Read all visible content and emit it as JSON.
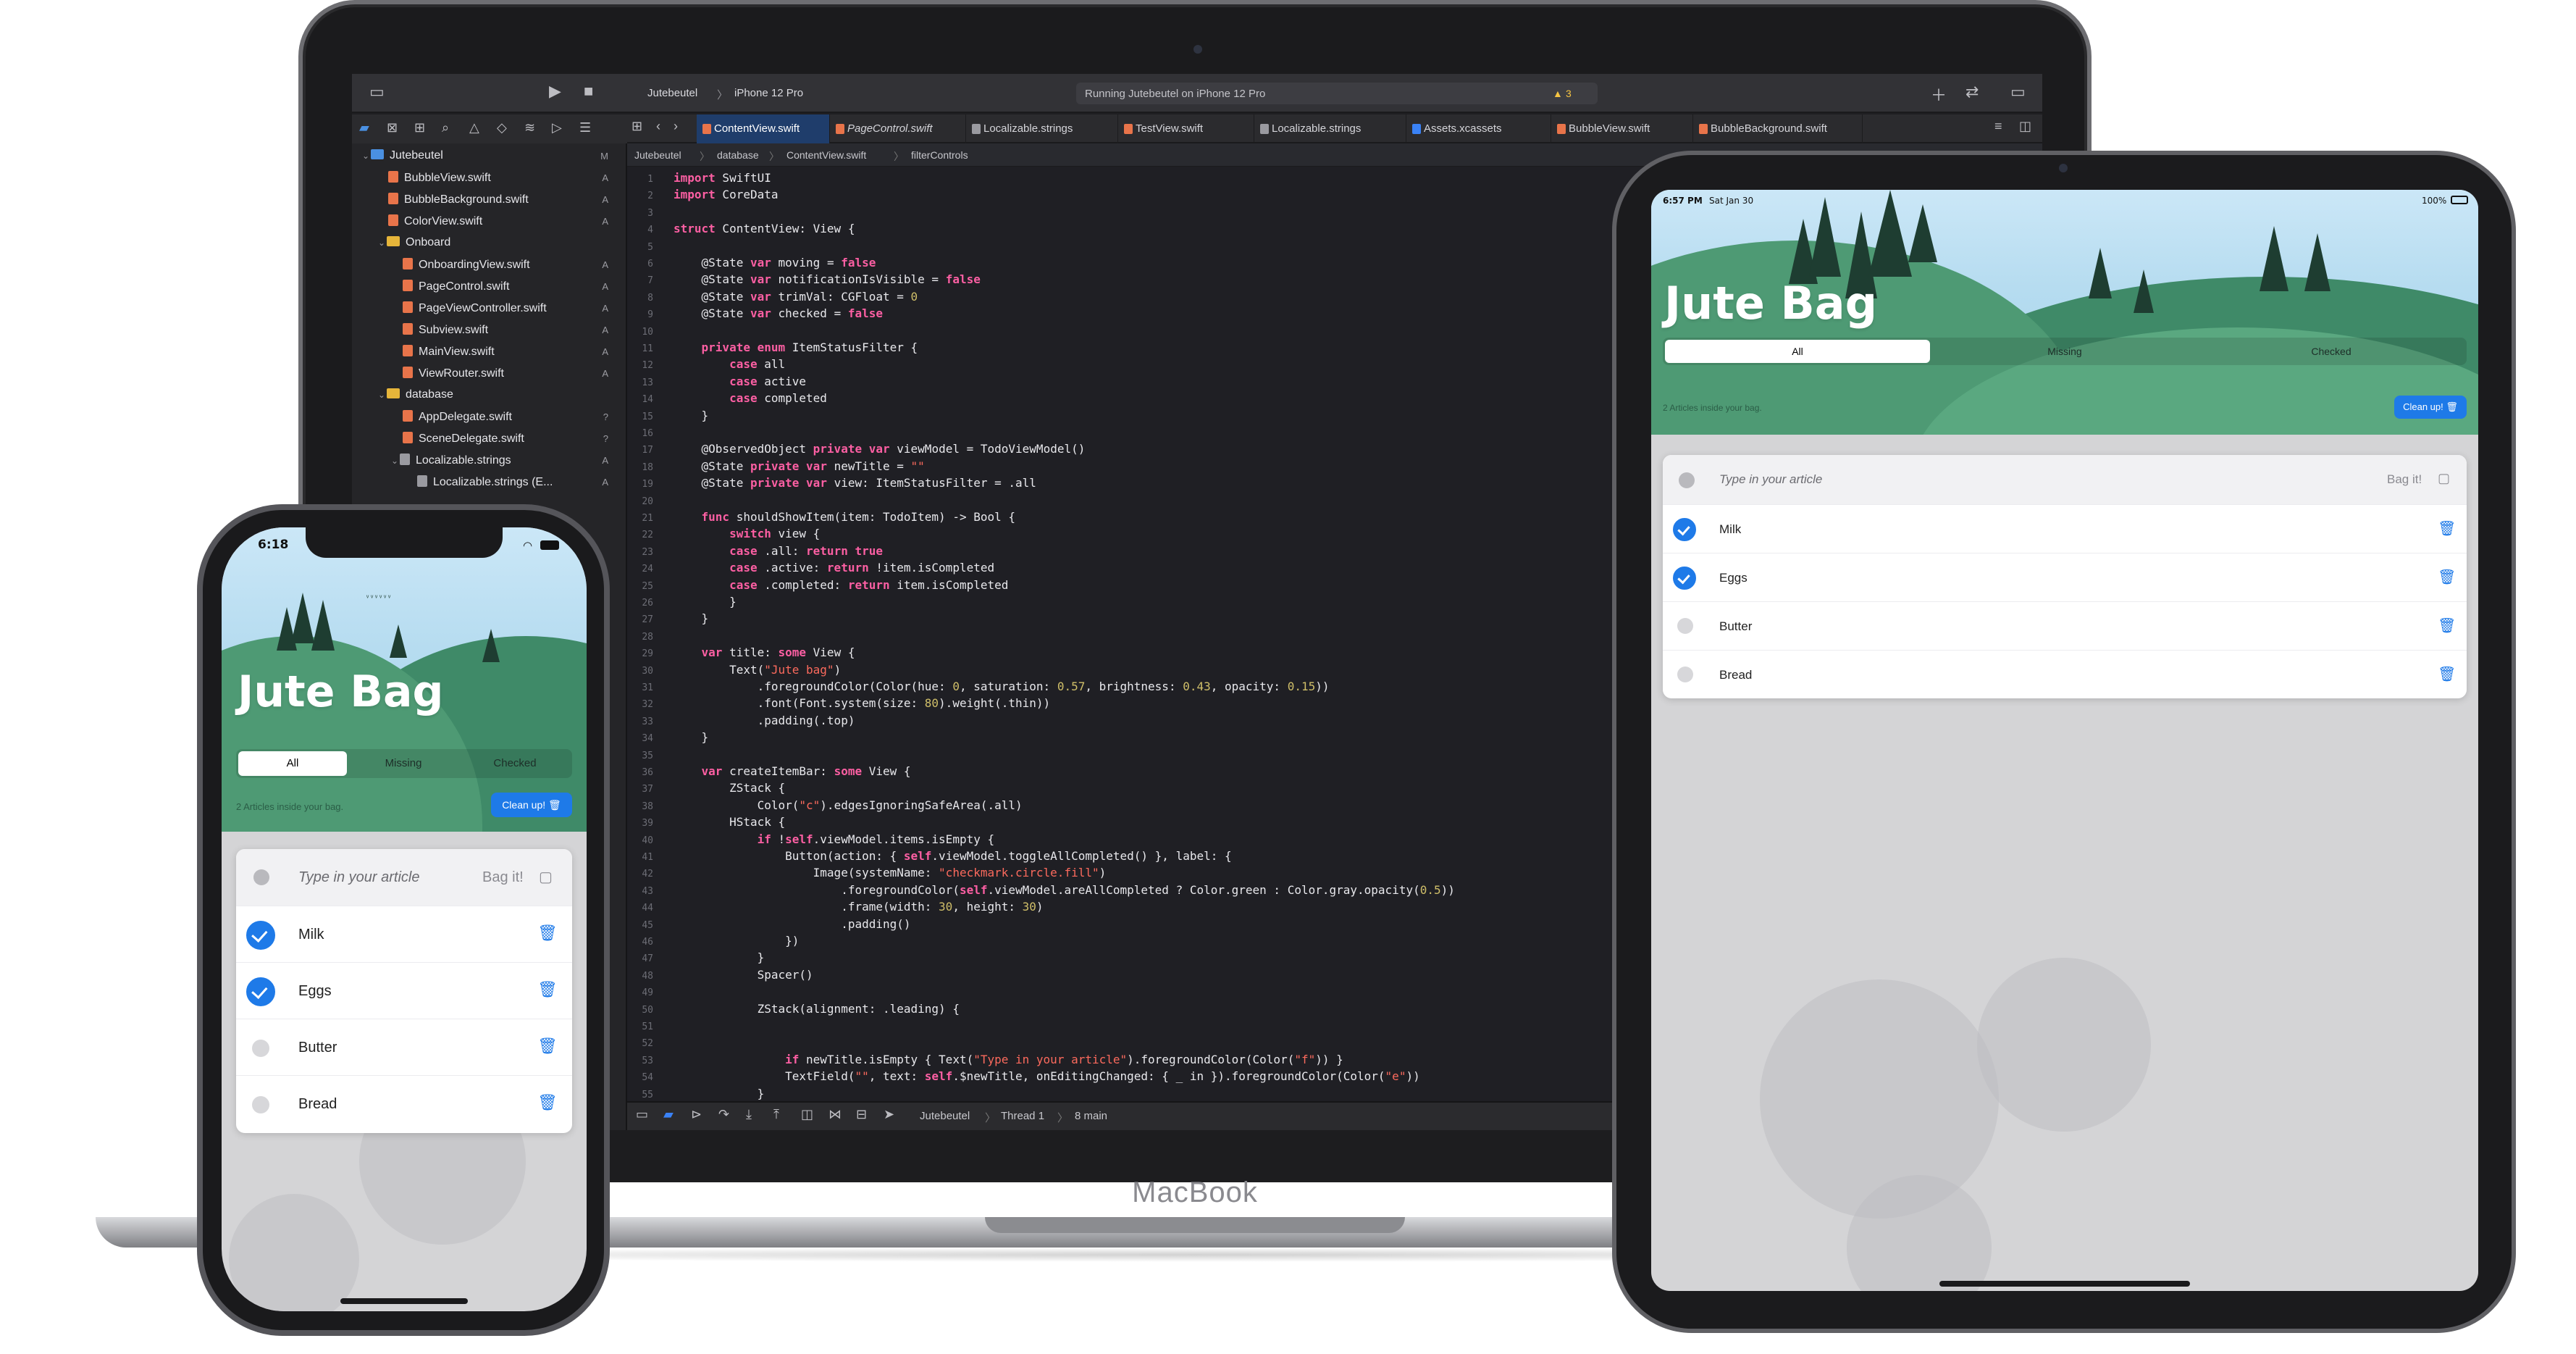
{
  "mac": {
    "brand": "MacBook",
    "toolbar": {
      "scheme": "Jutebeutel",
      "device": "iPhone 12 Pro",
      "status": "Running Jutebeutel on iPhone 12 Pro",
      "warnings": "3"
    },
    "tabs": [
      {
        "label": "ContentView.swift"
      },
      {
        "label": "PageControl.swift"
      },
      {
        "label": "Localizable.strings"
      },
      {
        "label": "TestView.swift"
      },
      {
        "label": "Localizable.strings"
      },
      {
        "label": "Assets.xcassets"
      },
      {
        "label": "BubbleView.swift"
      },
      {
        "label": "BubbleBackground.swift"
      }
    ],
    "jumpbar": [
      "Jutebeutel",
      "database",
      "ContentView.swift",
      "filterControls"
    ],
    "navigator": [
      {
        "label": "Jutebeutel",
        "badge": "M"
      },
      {
        "label": "BubbleView.swift",
        "badge": "A"
      },
      {
        "label": "BubbleBackground.swift",
        "badge": "A"
      },
      {
        "label": "ColorView.swift",
        "badge": "A"
      },
      {
        "label": "Onboard",
        "badge": ""
      },
      {
        "label": "OnboardingView.swift",
        "badge": "A"
      },
      {
        "label": "PageControl.swift",
        "badge": "A"
      },
      {
        "label": "PageViewController.swift",
        "badge": "A"
      },
      {
        "label": "Subview.swift",
        "badge": "A"
      },
      {
        "label": "MainView.swift",
        "badge": "A"
      },
      {
        "label": "ViewRouter.swift",
        "badge": "A"
      },
      {
        "label": "database",
        "badge": ""
      },
      {
        "label": "AppDelegate.swift",
        "badge": "?"
      },
      {
        "label": "SceneDelegate.swift",
        "badge": "?"
      },
      {
        "label": "Localizable.strings",
        "badge": "A"
      },
      {
        "label": "Localizable.strings (E...",
        "badge": "A"
      }
    ],
    "debug": {
      "target": "Jutebeutel",
      "thread": "Thread 1",
      "queue": "8 main"
    },
    "code": [
      "import SwiftUI",
      "import CoreData",
      "",
      "struct ContentView: View {",
      "",
      "    @State var moving = false",
      "    @State var notificationIsVisible = false",
      "    @State var trimVal: CGFloat = 0",
      "    @State var checked = false",
      "",
      "    private enum ItemStatusFilter {",
      "        case all",
      "        case active",
      "        case completed",
      "    }",
      "",
      "    @ObservedObject private var viewModel = TodoViewModel()",
      "    @State private var newTitle = \"\"",
      "    @State private var view: ItemStatusFilter = .all",
      "",
      "    func shouldShowItem(item: TodoItem) -> Bool {",
      "        switch view {",
      "        case .all: return true",
      "        case .active: return !item.isCompleted",
      "        case .completed: return item.isCompleted",
      "        }",
      "    }",
      "",
      "    var title: some View {",
      "        Text(\"Jute bag\")",
      "            .foregroundColor(Color(hue: 0, saturation: 0.57, brightness: 0.43, opacity: 0.15))",
      "            .font(Font.system(size: 80).weight(.thin))",
      "            .padding(.top)",
      "    }",
      "",
      "    var createItemBar: some View {",
      "        ZStack {",
      "            Color(\"c\").edgesIgnoringSafeArea(.all)",
      "        HStack {",
      "            if !self.viewModel.items.isEmpty {",
      "                Button(action: { self.viewModel.toggleAllCompleted() }, label: {",
      "                    Image(systemName: \"checkmark.circle.fill\")",
      "                        .foregroundColor(self.viewModel.areAllCompleted ? Color.green : Color.gray.opacity(0.5))",
      "                        .frame(width: 30, height: 30)",
      "                        .padding()",
      "                })",
      "            }",
      "            Spacer()",
      "",
      "            ZStack(alignment: .leading) {",
      "",
      "",
      "                if newTitle.isEmpty { Text(\"Type in your article\").foregroundColor(Color(\"f\")) }",
      "                TextField(\"\", text: self.$newTitle, onEditingChanged: { _ in }).foregroundColor(Color(\"e\"))",
      "            }"
    ]
  },
  "ipad": {
    "status_time": "6:57 PM",
    "status_date": "Sat Jan 30",
    "battery": "100%",
    "title": "Jute Bag",
    "segments": [
      "All",
      "Missing",
      "Checked"
    ],
    "count_text": "2 Articles inside your bag.",
    "clean_label": "Clean up!",
    "input_placeholder": "Type in your article",
    "bag_label": "Bag it!",
    "items": [
      {
        "name": "Milk",
        "checked": true
      },
      {
        "name": "Eggs",
        "checked": true
      },
      {
        "name": "Butter",
        "checked": false
      },
      {
        "name": "Bread",
        "checked": false
      }
    ]
  },
  "iphone": {
    "status_time": "6:18",
    "title": "Jute Bag",
    "segments": [
      "All",
      "Missing",
      "Checked"
    ],
    "count_text": "2 Articles inside your bag.",
    "clean_label": "Clean up!",
    "input_placeholder": "Type in your article",
    "bag_label": "Bag it!",
    "items": [
      {
        "name": "Milk",
        "checked": true
      },
      {
        "name": "Eggs",
        "checked": true
      },
      {
        "name": "Butter",
        "checked": false
      },
      {
        "name": "Bread",
        "checked": false
      }
    ]
  },
  "colors": {
    "accent": "#1e7ae8",
    "hill": "#4e9a74",
    "sky": "#b6dcf0",
    "xcode_bg": "#1f1f24"
  },
  "icons": [
    "play-icon",
    "stop-icon",
    "trash-icon",
    "checkmark-circle-icon",
    "folder-icon",
    "swift-file-icon",
    "wifi-icon",
    "battery-icon",
    "warning-icon"
  ]
}
